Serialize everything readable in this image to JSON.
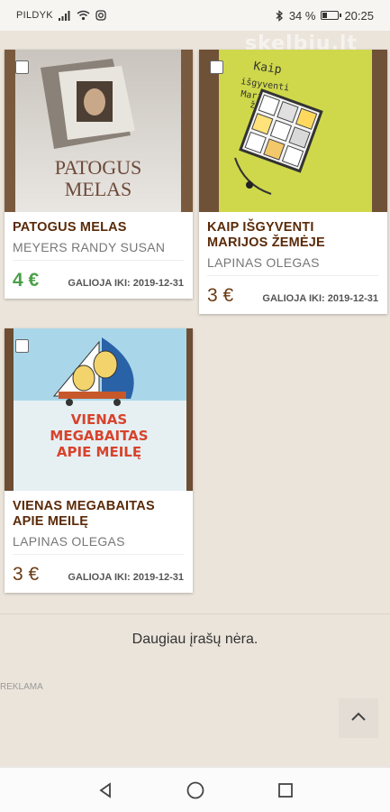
{
  "status": {
    "carrier": "PILDYK",
    "battery": "34 %",
    "time": "20:25",
    "battery_level": 0.34
  },
  "watermark": "skelbiu.lt",
  "cards": [
    {
      "title": "PATOGUS MELAS",
      "author": "MEYERS RANDY SUSAN",
      "price": "4 €",
      "valid": "GALIOJA IKI: 2019-12-31",
      "cover_text": "PATOGUS MELAS"
    },
    {
      "title": "KAIP IŠGYVENTI MARIJOS ŽEMĖJE",
      "author": "LAPINAS OLEGAS",
      "price": "3 €",
      "valid": "GALIOJA IKI: 2019-12-31",
      "cover_text_1": "Kaip",
      "cover_text_2": "išgyventi",
      "cover_text_3": "Marijos",
      "cover_text_4": "žemėje"
    },
    {
      "title": "VIENAS MEGABAITAS APIE MEILĘ",
      "author": "LAPINAS OLEGAS",
      "price": "3 €",
      "valid": "GALIOJA IKI: 2019-12-31",
      "cover_text_1": "VIENAS",
      "cover_text_2": "MEGABAITAS",
      "cover_text_3": "APIE MEILĘ"
    }
  ],
  "footer": {
    "no_more": "Daugiau įrašų nėra.",
    "ad_label": "REKLAMA"
  },
  "icons": {
    "back": "back-triangle-icon",
    "home": "home-circle-icon",
    "recents": "recents-square-icon",
    "scroll_top": "chevron-up-icon"
  },
  "colors": {
    "title": "#5a2a08",
    "price_green": "#4aa048",
    "price_brown": "#6b3a12",
    "background": "#ebe4db"
  }
}
